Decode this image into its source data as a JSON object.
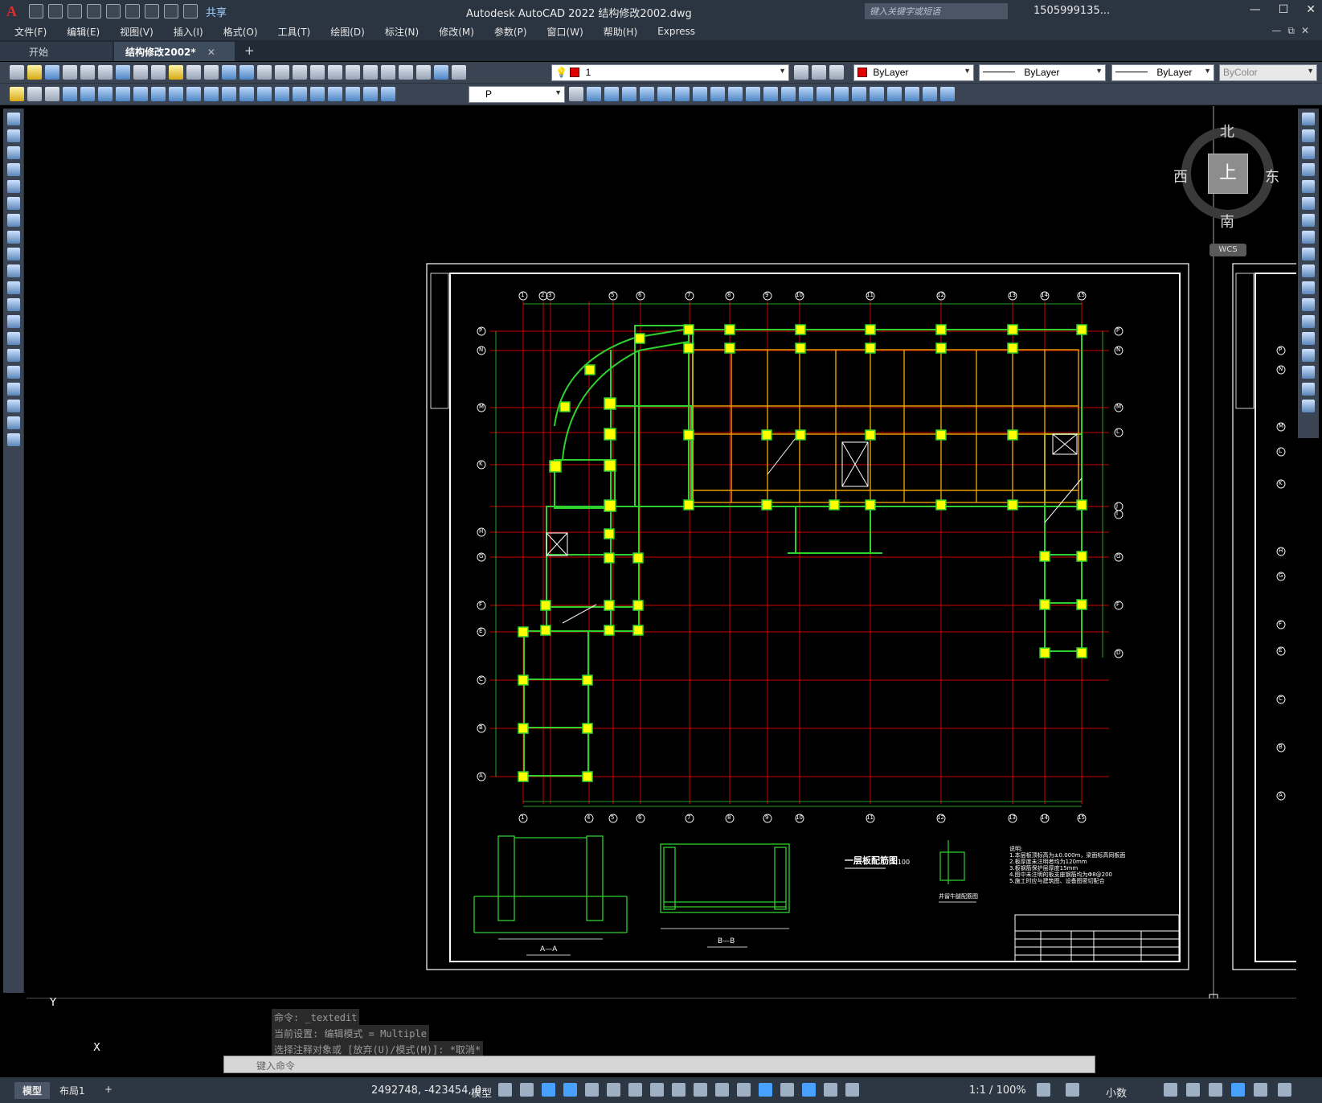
{
  "titlebar": {
    "logo": "A",
    "share": "共享",
    "title": "Autodesk AutoCAD 2022    结构修改2002.dwg",
    "search_placeholder": "键入关键字或短语",
    "user": "1505999135...",
    "win_min": "—",
    "win_max": "☐",
    "win_close": "✕"
  },
  "menu": {
    "items": [
      "文件(F)",
      "编辑(E)",
      "视图(V)",
      "插入(I)",
      "格式(O)",
      "工具(T)",
      "绘图(D)",
      "标注(N)",
      "修改(M)",
      "参数(P)",
      "窗口(W)",
      "帮助(H)",
      "Express"
    ]
  },
  "tabs": {
    "start": "开始",
    "active": "结构修改2002*",
    "close": "✕",
    "add": "+"
  },
  "toolbar": {
    "layer_value": "1",
    "color": "ByLayer",
    "linetype": "ByLayer",
    "lineweight": "ByLayer",
    "plotstyle": "ByColor",
    "textstyle": "P"
  },
  "viewcube": {
    "north": "北",
    "south": "南",
    "east": "东",
    "west": "西",
    "top": "上",
    "wcs": "WCS"
  },
  "drawing": {
    "plan_title": "一层板配筋图",
    "plan_scale": "1:100",
    "section_a": "A—A",
    "section_b": "B—B",
    "detail_title": "井留牛腿配筋图",
    "notes_title": "说明:",
    "notes": [
      "1.本层板顶标高为±0.000m，梁面标高同板面",
      "2.板厚度未注明者均为120mm",
      "3.板钢筋保护层厚度15mm",
      "4.图中未注明的板支座钢筋均为Φ8@200",
      "5.施工时应与建筑图、设备图密切配合"
    ],
    "grid_top": [
      "1",
      "2",
      "3",
      "5",
      "6",
      "7",
      "8",
      "9",
      "10",
      "11",
      "12",
      "13",
      "14",
      "15"
    ],
    "grid_bottom": [
      "1",
      "4",
      "5",
      "6",
      "7",
      "8",
      "9",
      "10",
      "11",
      "12",
      "13",
      "14",
      "15"
    ],
    "grid_left": [
      "P",
      "N",
      "M",
      "K",
      "H",
      "G",
      "F",
      "E",
      "C",
      "B",
      "A"
    ],
    "grid_right": [
      "P",
      "N",
      "M",
      "L",
      "J",
      "I",
      "G",
      "F",
      "D"
    ],
    "right_letters": [
      "P",
      "N",
      "M",
      "L",
      "K",
      "H",
      "G",
      "F",
      "E",
      "C",
      "B",
      "A"
    ]
  },
  "ucs": {
    "y": "Y",
    "x": "X"
  },
  "command": {
    "history": [
      "命令: _textedit",
      "当前设置: 编辑模式 = Multiple",
      "选择注释对象或 [放弃(U)/模式(M)]: *取消*"
    ],
    "placeholder": "键入命令"
  },
  "status": {
    "model_tab": "模型",
    "layout_tab": "布局1",
    "add": "+",
    "coords": "2492748, -423454, 0",
    "space": "模型",
    "scale": "1:1 / 100%",
    "units": "小数"
  }
}
